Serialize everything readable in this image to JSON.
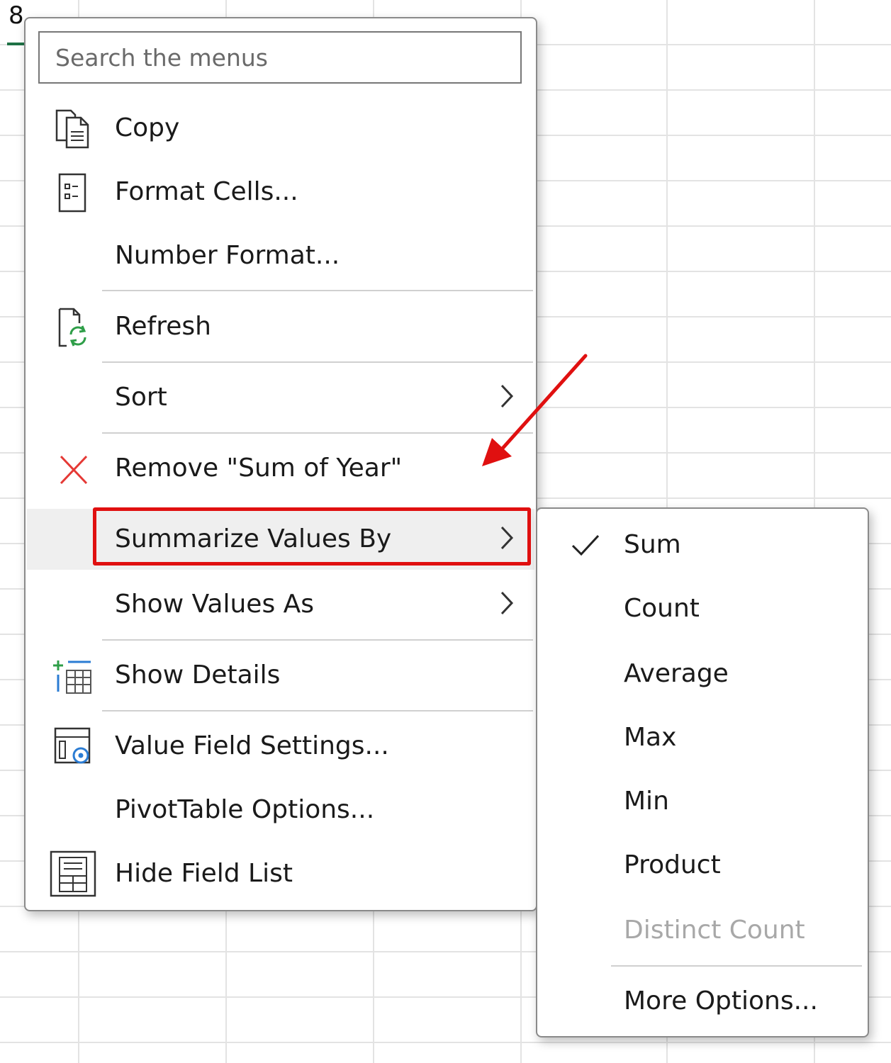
{
  "sheet": {
    "cell_text": "8"
  },
  "search": {
    "placeholder": "Search the menus"
  },
  "context_menu": {
    "items": [
      {
        "label": "Copy",
        "icon": "copy-icon"
      },
      {
        "label": "Format Cells...",
        "icon": "format-cells-icon"
      },
      {
        "label": "Number Format...",
        "icon": ""
      },
      {
        "label": "Refresh",
        "icon": "refresh-icon"
      },
      {
        "label": "Sort",
        "icon": "",
        "submenu": true
      },
      {
        "label": "Remove \"Sum of Year\"",
        "icon": "remove-icon"
      },
      {
        "label": "Summarize Values By",
        "icon": "",
        "submenu": true,
        "highlighted": true
      },
      {
        "label": "Show Values As",
        "icon": "",
        "submenu": true
      },
      {
        "label": "Show Details",
        "icon": "show-details-icon"
      },
      {
        "label": "Value Field Settings...",
        "icon": "value-field-settings-icon"
      },
      {
        "label": "PivotTable Options...",
        "icon": ""
      },
      {
        "label": "Hide Field List",
        "icon": "field-list-icon"
      }
    ]
  },
  "submenu": {
    "items": [
      {
        "label": "Sum",
        "checked": true
      },
      {
        "label": "Count"
      },
      {
        "label": "Average"
      },
      {
        "label": "Max"
      },
      {
        "label": "Min"
      },
      {
        "label": "Product"
      },
      {
        "label": "Distinct Count",
        "disabled": true
      },
      {
        "label": "More Options..."
      }
    ]
  },
  "colors": {
    "highlight_border": "#e01010",
    "annotation_arrow": "#e01010",
    "refresh_green": "#2e9e48",
    "icon_blue": "#2b7cd3"
  }
}
